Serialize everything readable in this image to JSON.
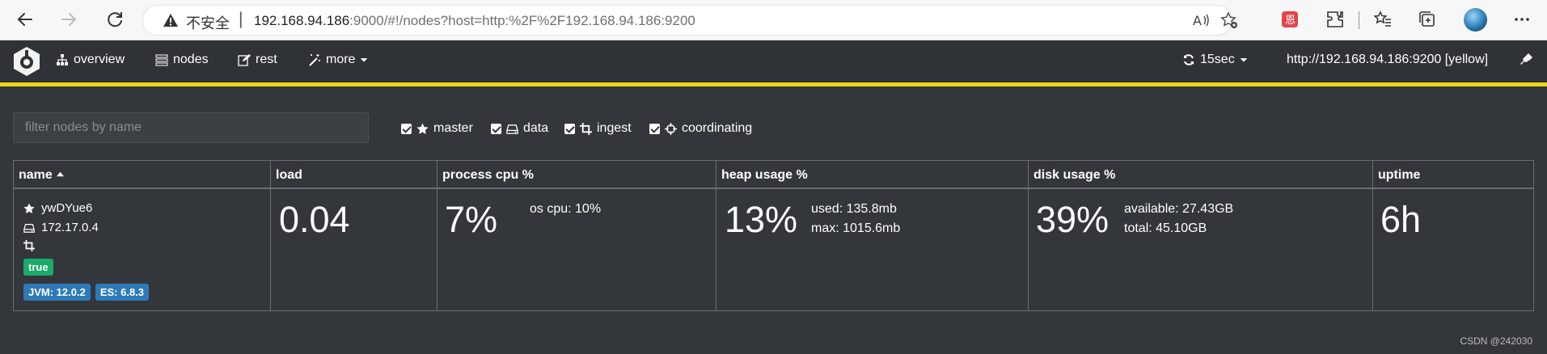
{
  "browser": {
    "insecure_label": "不安全",
    "url_host": "192.168.94.186",
    "url_rest": ":9000/#!/nodes?host=http:%2F%2F192.168.94.186:9200"
  },
  "nav": {
    "items": [
      {
        "label": "overview",
        "icon": "sitemap-icon"
      },
      {
        "label": "nodes",
        "icon": "server-icon"
      },
      {
        "label": "rest",
        "icon": "edit-icon"
      },
      {
        "label": "more",
        "icon": "magic-icon"
      }
    ],
    "refresh_label": "15sec",
    "cluster_url": "http://192.168.94.186:9200 [yellow]"
  },
  "filter": {
    "placeholder": "filter nodes by name"
  },
  "roles": [
    {
      "label": "master",
      "checked": true
    },
    {
      "label": "data",
      "checked": true
    },
    {
      "label": "ingest",
      "checked": true
    },
    {
      "label": "coordinating",
      "checked": true
    }
  ],
  "table": {
    "headers": [
      "name",
      "load",
      "process cpu %",
      "heap usage %",
      "disk usage %",
      "uptime"
    ],
    "row": {
      "name": "ywDYue6",
      "ip": "172.17.0.4",
      "badge_true": "true",
      "badge_jvm": "JVM: 12.0.2",
      "badge_es": "ES: 6.8.3",
      "load": "0.04",
      "cpu": "7%",
      "os_cpu": "os cpu: 10%",
      "heap": "13%",
      "heap_used": "used: 135.8mb",
      "heap_max": "max: 1015.6mb",
      "disk": "39%",
      "disk_available": "available: 27.43GB",
      "disk_total": "total: 45.10GB",
      "uptime": "6h"
    }
  },
  "colors": {
    "accent_yellow": "#ecd41f",
    "badge_green": "#1aab6b",
    "badge_blue": "#2e7ab8"
  },
  "watermark": "CSDN @242030"
}
